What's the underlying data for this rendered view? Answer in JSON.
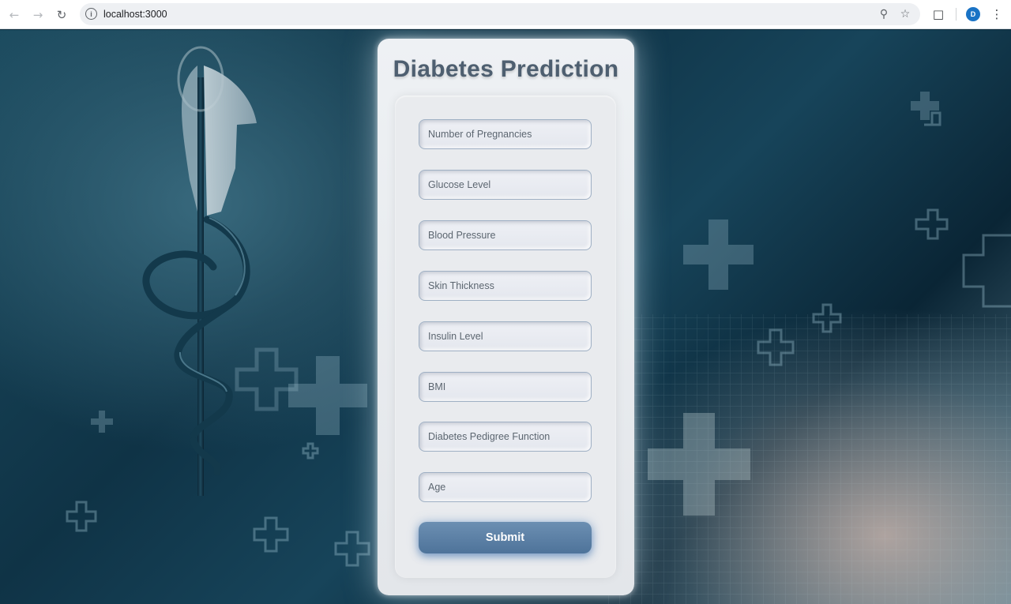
{
  "browser": {
    "url": "localhost:3000",
    "profile_initial": "D",
    "icons": {
      "back": "arrow-left",
      "forward": "arrow-right",
      "reload": "reload",
      "site_info": "info",
      "zoom": "zoom-out",
      "bookmark": "star",
      "extensions": "puzzle",
      "menu": "kebab"
    }
  },
  "page": {
    "title": "Diabetes Prediction",
    "fields": [
      {
        "placeholder": "Number of Pregnancies",
        "value": ""
      },
      {
        "placeholder": "Glucose Level",
        "value": ""
      },
      {
        "placeholder": "Blood Pressure",
        "value": ""
      },
      {
        "placeholder": "Skin Thickness",
        "value": ""
      },
      {
        "placeholder": "Insulin Level",
        "value": ""
      },
      {
        "placeholder": "BMI",
        "value": ""
      },
      {
        "placeholder": "Diabetes Pedigree Function",
        "value": ""
      },
      {
        "placeholder": "Age",
        "value": ""
      }
    ],
    "submit_label": "Submit"
  },
  "colors": {
    "title": "#4e5f70",
    "submit_bg": "#5b7fa6",
    "background_dark": "#0f3346"
  }
}
